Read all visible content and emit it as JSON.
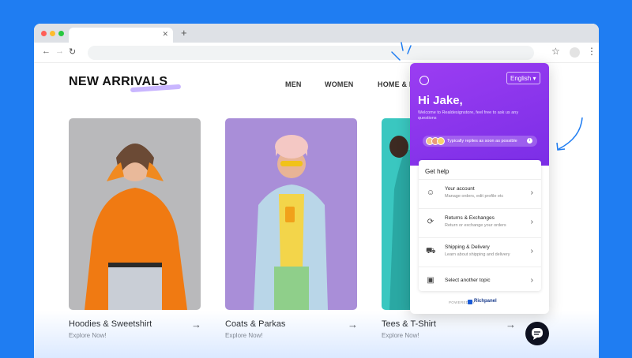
{
  "store": {
    "heading": "NEW ARRIVALS",
    "nav": [
      "MEN",
      "WOMEN",
      "HOME & L"
    ],
    "products": [
      {
        "title": "Hoodies & Sweetshirt",
        "cta": "Explore Now!"
      },
      {
        "title": "Coats & Parkas",
        "cta": "Explore Now!"
      },
      {
        "title": "Tees & T-Shirt",
        "cta": "Explore Now!"
      }
    ]
  },
  "widget": {
    "language": "English",
    "greeting": "Hi Jake,",
    "welcome": "Welcome to Realdesignstore, feel free to ask us any questions",
    "reply_time": "Typically replies as soon as possible",
    "help_title": "Get help",
    "items": [
      {
        "title": "Your account",
        "subtitle": "Manage orders, edit profile etc",
        "icon": "user-icon"
      },
      {
        "title": "Returns & Exchanges",
        "subtitle": "Return or exchange your orders",
        "icon": "refresh-icon"
      },
      {
        "title": "Shipping & Delivery",
        "subtitle": "Learn about shipping and delivery",
        "icon": "truck-icon"
      },
      {
        "title": "Select another topic",
        "subtitle": "",
        "icon": "info-icon"
      }
    ],
    "powered_by": "POWERED BY",
    "brand": "Richpanel"
  },
  "colors": {
    "background": "#1f7df2",
    "widget_accent": "#8b35ee",
    "card1_bg": "#b9b9bb",
    "card2_bg": "#a98ed8",
    "card3_bg": "#3ac7c0"
  }
}
